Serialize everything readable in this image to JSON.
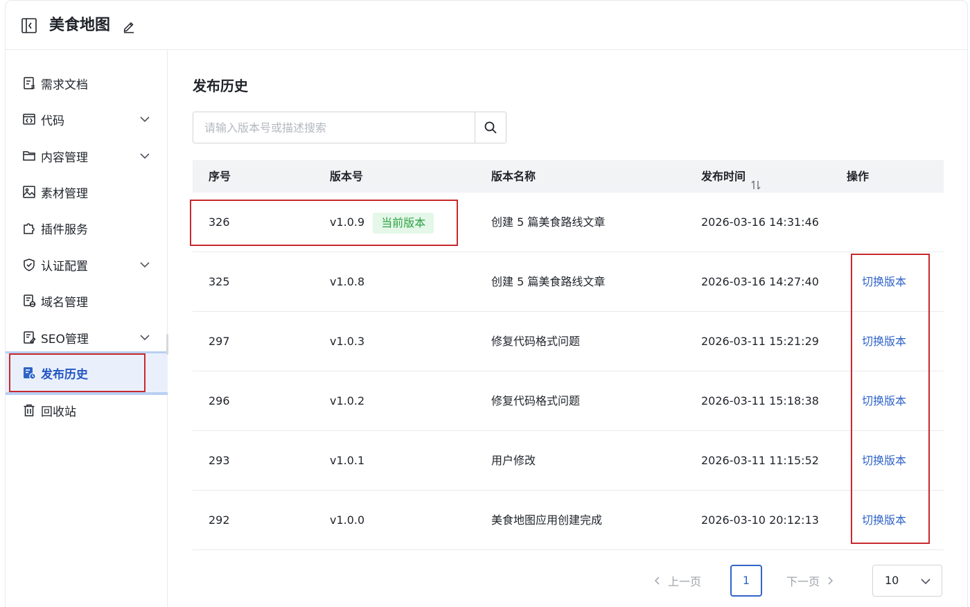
{
  "header": {
    "title": "美食地图"
  },
  "sidebar": {
    "items": [
      {
        "label": "需求文档",
        "icon": "document-icon",
        "expandable": false
      },
      {
        "label": "代码",
        "icon": "code-icon",
        "expandable": true
      },
      {
        "label": "内容管理",
        "icon": "folder-icon",
        "expandable": true
      },
      {
        "label": "素材管理",
        "icon": "image-icon",
        "expandable": false
      },
      {
        "label": "插件服务",
        "icon": "puzzle-icon",
        "expandable": false
      },
      {
        "label": "认证配置",
        "icon": "shield-icon",
        "expandable": true
      },
      {
        "label": "域名管理",
        "icon": "domain-icon",
        "expandable": false
      },
      {
        "label": "SEO管理",
        "icon": "seo-icon",
        "expandable": true
      },
      {
        "label": "发布历史",
        "icon": "publish-history-icon",
        "expandable": false,
        "active": true
      },
      {
        "label": "回收站",
        "icon": "trash-icon",
        "expandable": false
      }
    ]
  },
  "main": {
    "title": "发布历史",
    "search": {
      "placeholder": "请输入版本号或描述搜索",
      "value": ""
    },
    "table": {
      "columns": [
        "序号",
        "版本号",
        "版本名称",
        "发布时间",
        "操作"
      ],
      "current_badge": "当前版本",
      "action_label": "切换版本",
      "rows": [
        {
          "id": "326",
          "version": "v1.0.9",
          "name": "创建 5 篇美食路线文章",
          "time": "2026-03-16 14:31:46",
          "current": true
        },
        {
          "id": "325",
          "version": "v1.0.8",
          "name": "创建 5 篇美食路线文章",
          "time": "2026-03-16 14:27:40",
          "current": false
        },
        {
          "id": "297",
          "version": "v1.0.3",
          "name": "修复代码格式问题",
          "time": "2026-03-11 15:21:29",
          "current": false
        },
        {
          "id": "296",
          "version": "v1.0.2",
          "name": "修复代码格式问题",
          "time": "2026-03-11 15:18:38",
          "current": false
        },
        {
          "id": "293",
          "version": "v1.0.1",
          "name": "用户修改",
          "time": "2026-03-11 11:15:52",
          "current": false
        },
        {
          "id": "292",
          "version": "v1.0.0",
          "name": "美食地图应用创建完成",
          "time": "2026-03-10 20:12:13",
          "current": false
        }
      ]
    },
    "pagination": {
      "prev": "上一页",
      "next": "下一页",
      "current_page": "1",
      "page_size": "10"
    }
  },
  "colors": {
    "accent": "#2f63c8",
    "highlight_box": "#c8282c",
    "badge_bg": "#e4f7e8",
    "badge_text": "#2ea343"
  }
}
